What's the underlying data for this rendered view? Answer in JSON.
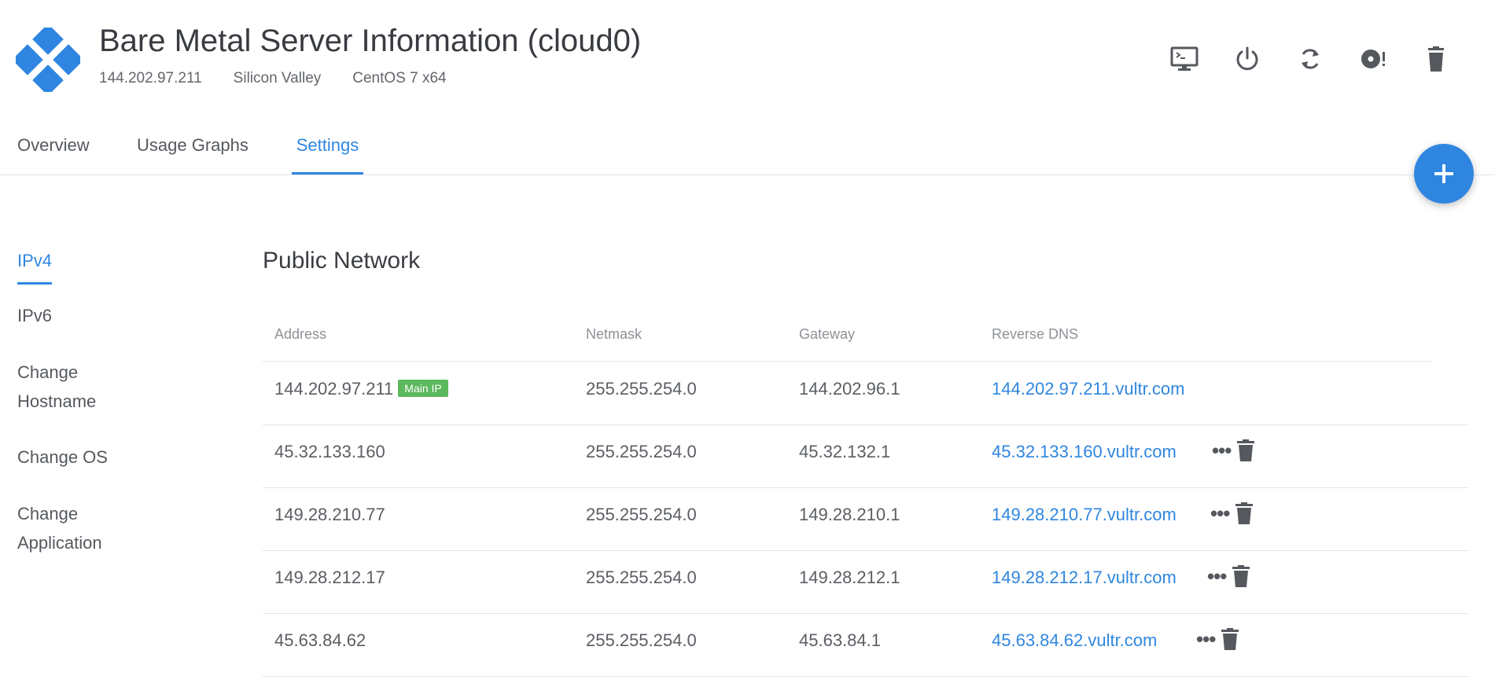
{
  "header": {
    "title": "Bare Metal Server Information (cloud0)",
    "ip": "144.202.97.211",
    "location": "Silicon Valley",
    "os": "CentOS 7 x64",
    "logo_icon": "vultr-diamond-logo",
    "brand_color": "#2f86e0",
    "actions": [
      "console-icon",
      "power-icon",
      "restart-icon",
      "reinstall-icon",
      "trash-icon"
    ]
  },
  "tabs": [
    {
      "label": "Overview",
      "active": false
    },
    {
      "label": "Usage Graphs",
      "active": false
    },
    {
      "label": "Settings",
      "active": true
    }
  ],
  "fab": {
    "label": "+"
  },
  "sidebar": {
    "items": [
      {
        "label": "IPv4",
        "active": true
      },
      {
        "label": "IPv6",
        "active": false
      },
      {
        "label": "Change Hostname",
        "active": false
      },
      {
        "label": "Change OS",
        "active": false
      },
      {
        "label": "Change Application",
        "active": false
      }
    ]
  },
  "network": {
    "title": "Public Network",
    "columns": [
      "Address",
      "Netmask",
      "Gateway",
      "Reverse DNS"
    ],
    "rows": [
      {
        "address": "144.202.97.211",
        "badge": "Main IP",
        "netmask": "255.255.254.0",
        "gateway": "144.202.96.1",
        "rdns": "144.202.97.211.vultr.com"
      },
      {
        "address": "45.32.133.160",
        "badge": "",
        "netmask": "255.255.254.0",
        "gateway": "45.32.132.1",
        "rdns": "45.32.133.160.vultr.com"
      },
      {
        "address": "149.28.210.77",
        "badge": "",
        "netmask": "255.255.254.0",
        "gateway": "149.28.210.1",
        "rdns": "149.28.210.77.vultr.com"
      },
      {
        "address": "149.28.212.17",
        "badge": "",
        "netmask": "255.255.254.0",
        "gateway": "149.28.212.1",
        "rdns": "149.28.212.17.vultr.com"
      },
      {
        "address": "45.63.84.62",
        "badge": "",
        "netmask": "255.255.254.0",
        "gateway": "45.63.84.1",
        "rdns": "45.63.84.62.vultr.com"
      }
    ],
    "more_icon": "ellipsis-icon",
    "delete_icon": "trash-icon",
    "badge_color": "#5cb85c"
  }
}
